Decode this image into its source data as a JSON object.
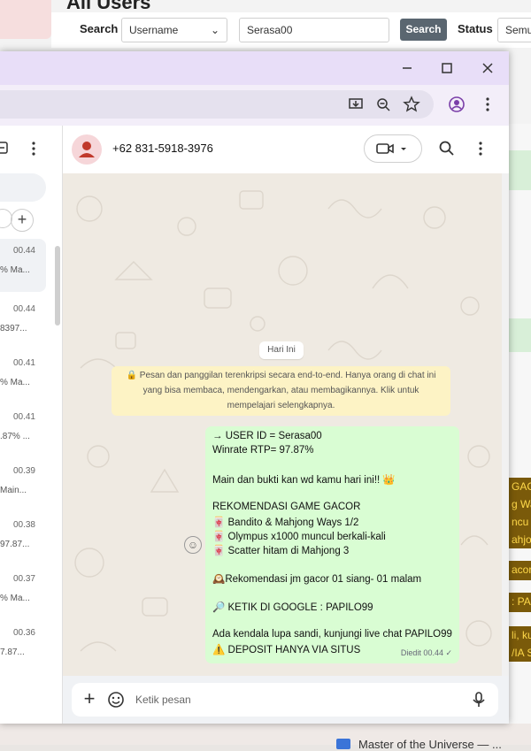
{
  "admin": {
    "heading": "All Users",
    "search_label": "Search",
    "search_field_option": "Username",
    "search_value": "Serasa00",
    "search_button": "Search",
    "status_label": "Status",
    "status_value": "Semua",
    "promo_lines": [
      "GAC",
      "g Wa",
      "ncu",
      "ahjo",
      "acor",
      ": PA",
      "li, ku",
      "/IA S"
    ],
    "taskbar_text": "Master of the Universe — ..."
  },
  "chrome": {
    "minimize_icon": "minimize-icon",
    "maximize_icon": "maximize-icon",
    "close_icon": "close-icon"
  },
  "whatsapp": {
    "contact_phone": "+62 831-5918-3976",
    "date_chip": "Hari Ini",
    "encryption_notice": "🔒 Pesan dan panggilan terenkripsi secara end-to-end. Hanya orang di chat ini yang bisa membaca, mendengarkan, atau membagikannya. Klik untuk mempelajari selengkapnya.",
    "composer_placeholder": "Ketik pesan",
    "sidebar_chats": [
      {
        "time": "00.44",
        "snippet": "% Ma..."
      },
      {
        "time": "00.44",
        "snippet": "8397..."
      },
      {
        "time": "00.41",
        "snippet": "% Ma..."
      },
      {
        "time": "00.41",
        "snippet": ".87% ..."
      },
      {
        "time": "00.39",
        "snippet": "Main..."
      },
      {
        "time": "00.38",
        "snippet": "97.87..."
      },
      {
        "time": "00.37",
        "snippet": "% Ma..."
      },
      {
        "time": "00.36",
        "snippet": "7.87..."
      }
    ],
    "message": {
      "lines": [
        "→ USER ID = Serasa00",
        "Winrate RTP= 97.87%",
        "",
        "Main dan bukti kan wd kamu hari ini!! 👑",
        "",
        "REKOMENDASI GAME GACOR",
        "🀄 Bandito & Mahjong Ways 1/2",
        "🀄 Olympus x1000 muncul berkali-kali",
        "🀄 Scatter hitam di Mahjong 3",
        "",
        "🕰️Rekomendasi jm gacor 01 siang- 01 malam",
        "",
        "🔎 KETIK DI GOOGLE : PAPILO99",
        "",
        "Ada kendala lupa sandi, kunjungi live chat PAPILO99",
        "⚠️ DEPOSIT HANYA VIA SITUS"
      ],
      "meta": "Diedit 00.44 ✓"
    }
  }
}
